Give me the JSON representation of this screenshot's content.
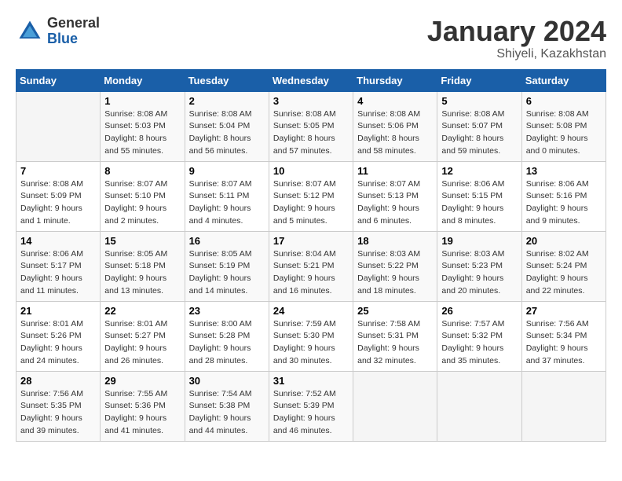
{
  "header": {
    "logo_general": "General",
    "logo_blue": "Blue",
    "month_title": "January 2024",
    "location": "Shiyeli, Kazakhstan"
  },
  "weekdays": [
    "Sunday",
    "Monday",
    "Tuesday",
    "Wednesday",
    "Thursday",
    "Friday",
    "Saturday"
  ],
  "weeks": [
    [
      {
        "day": "",
        "sunrise": "",
        "sunset": "",
        "daylight": ""
      },
      {
        "day": "1",
        "sunrise": "Sunrise: 8:08 AM",
        "sunset": "Sunset: 5:03 PM",
        "daylight": "Daylight: 8 hours and 55 minutes."
      },
      {
        "day": "2",
        "sunrise": "Sunrise: 8:08 AM",
        "sunset": "Sunset: 5:04 PM",
        "daylight": "Daylight: 8 hours and 56 minutes."
      },
      {
        "day": "3",
        "sunrise": "Sunrise: 8:08 AM",
        "sunset": "Sunset: 5:05 PM",
        "daylight": "Daylight: 8 hours and 57 minutes."
      },
      {
        "day": "4",
        "sunrise": "Sunrise: 8:08 AM",
        "sunset": "Sunset: 5:06 PM",
        "daylight": "Daylight: 8 hours and 58 minutes."
      },
      {
        "day": "5",
        "sunrise": "Sunrise: 8:08 AM",
        "sunset": "Sunset: 5:07 PM",
        "daylight": "Daylight: 8 hours and 59 minutes."
      },
      {
        "day": "6",
        "sunrise": "Sunrise: 8:08 AM",
        "sunset": "Sunset: 5:08 PM",
        "daylight": "Daylight: 9 hours and 0 minutes."
      }
    ],
    [
      {
        "day": "7",
        "sunrise": "Sunrise: 8:08 AM",
        "sunset": "Sunset: 5:09 PM",
        "daylight": "Daylight: 9 hours and 1 minute."
      },
      {
        "day": "8",
        "sunrise": "Sunrise: 8:07 AM",
        "sunset": "Sunset: 5:10 PM",
        "daylight": "Daylight: 9 hours and 2 minutes."
      },
      {
        "day": "9",
        "sunrise": "Sunrise: 8:07 AM",
        "sunset": "Sunset: 5:11 PM",
        "daylight": "Daylight: 9 hours and 4 minutes."
      },
      {
        "day": "10",
        "sunrise": "Sunrise: 8:07 AM",
        "sunset": "Sunset: 5:12 PM",
        "daylight": "Daylight: 9 hours and 5 minutes."
      },
      {
        "day": "11",
        "sunrise": "Sunrise: 8:07 AM",
        "sunset": "Sunset: 5:13 PM",
        "daylight": "Daylight: 9 hours and 6 minutes."
      },
      {
        "day": "12",
        "sunrise": "Sunrise: 8:06 AM",
        "sunset": "Sunset: 5:15 PM",
        "daylight": "Daylight: 9 hours and 8 minutes."
      },
      {
        "day": "13",
        "sunrise": "Sunrise: 8:06 AM",
        "sunset": "Sunset: 5:16 PM",
        "daylight": "Daylight: 9 hours and 9 minutes."
      }
    ],
    [
      {
        "day": "14",
        "sunrise": "Sunrise: 8:06 AM",
        "sunset": "Sunset: 5:17 PM",
        "daylight": "Daylight: 9 hours and 11 minutes."
      },
      {
        "day": "15",
        "sunrise": "Sunrise: 8:05 AM",
        "sunset": "Sunset: 5:18 PM",
        "daylight": "Daylight: 9 hours and 13 minutes."
      },
      {
        "day": "16",
        "sunrise": "Sunrise: 8:05 AM",
        "sunset": "Sunset: 5:19 PM",
        "daylight": "Daylight: 9 hours and 14 minutes."
      },
      {
        "day": "17",
        "sunrise": "Sunrise: 8:04 AM",
        "sunset": "Sunset: 5:21 PM",
        "daylight": "Daylight: 9 hours and 16 minutes."
      },
      {
        "day": "18",
        "sunrise": "Sunrise: 8:03 AM",
        "sunset": "Sunset: 5:22 PM",
        "daylight": "Daylight: 9 hours and 18 minutes."
      },
      {
        "day": "19",
        "sunrise": "Sunrise: 8:03 AM",
        "sunset": "Sunset: 5:23 PM",
        "daylight": "Daylight: 9 hours and 20 minutes."
      },
      {
        "day": "20",
        "sunrise": "Sunrise: 8:02 AM",
        "sunset": "Sunset: 5:24 PM",
        "daylight": "Daylight: 9 hours and 22 minutes."
      }
    ],
    [
      {
        "day": "21",
        "sunrise": "Sunrise: 8:01 AM",
        "sunset": "Sunset: 5:26 PM",
        "daylight": "Daylight: 9 hours and 24 minutes."
      },
      {
        "day": "22",
        "sunrise": "Sunrise: 8:01 AM",
        "sunset": "Sunset: 5:27 PM",
        "daylight": "Daylight: 9 hours and 26 minutes."
      },
      {
        "day": "23",
        "sunrise": "Sunrise: 8:00 AM",
        "sunset": "Sunset: 5:28 PM",
        "daylight": "Daylight: 9 hours and 28 minutes."
      },
      {
        "day": "24",
        "sunrise": "Sunrise: 7:59 AM",
        "sunset": "Sunset: 5:30 PM",
        "daylight": "Daylight: 9 hours and 30 minutes."
      },
      {
        "day": "25",
        "sunrise": "Sunrise: 7:58 AM",
        "sunset": "Sunset: 5:31 PM",
        "daylight": "Daylight: 9 hours and 32 minutes."
      },
      {
        "day": "26",
        "sunrise": "Sunrise: 7:57 AM",
        "sunset": "Sunset: 5:32 PM",
        "daylight": "Daylight: 9 hours and 35 minutes."
      },
      {
        "day": "27",
        "sunrise": "Sunrise: 7:56 AM",
        "sunset": "Sunset: 5:34 PM",
        "daylight": "Daylight: 9 hours and 37 minutes."
      }
    ],
    [
      {
        "day": "28",
        "sunrise": "Sunrise: 7:56 AM",
        "sunset": "Sunset: 5:35 PM",
        "daylight": "Daylight: 9 hours and 39 minutes."
      },
      {
        "day": "29",
        "sunrise": "Sunrise: 7:55 AM",
        "sunset": "Sunset: 5:36 PM",
        "daylight": "Daylight: 9 hours and 41 minutes."
      },
      {
        "day": "30",
        "sunrise": "Sunrise: 7:54 AM",
        "sunset": "Sunset: 5:38 PM",
        "daylight": "Daylight: 9 hours and 44 minutes."
      },
      {
        "day": "31",
        "sunrise": "Sunrise: 7:52 AM",
        "sunset": "Sunset: 5:39 PM",
        "daylight": "Daylight: 9 hours and 46 minutes."
      },
      {
        "day": "",
        "sunrise": "",
        "sunset": "",
        "daylight": ""
      },
      {
        "day": "",
        "sunrise": "",
        "sunset": "",
        "daylight": ""
      },
      {
        "day": "",
        "sunrise": "",
        "sunset": "",
        "daylight": ""
      }
    ]
  ]
}
